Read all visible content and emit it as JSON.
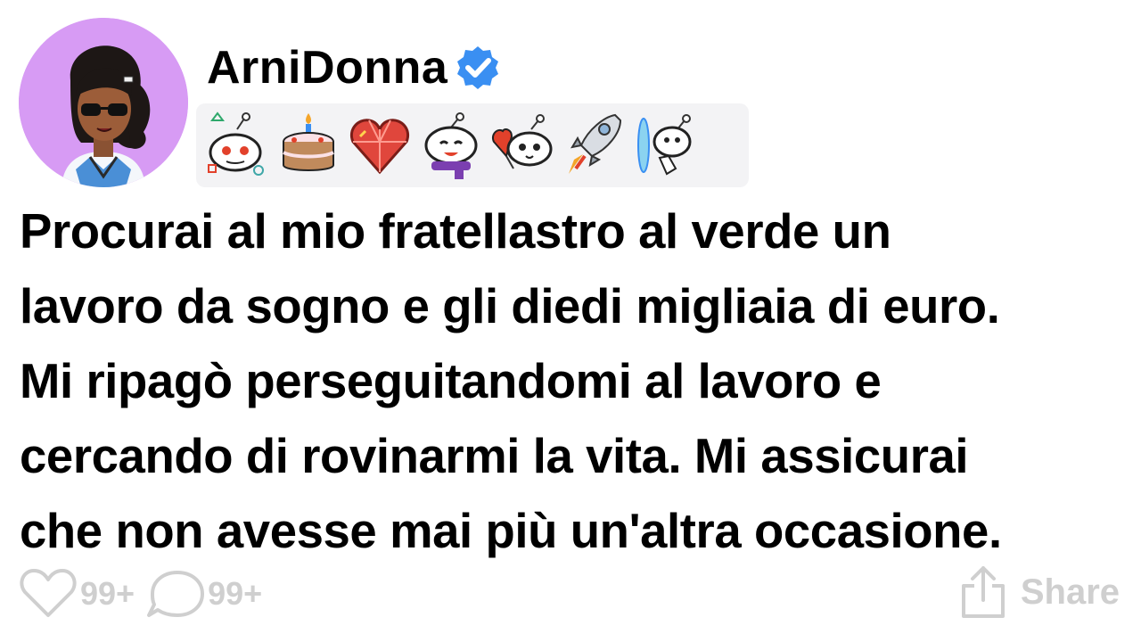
{
  "post": {
    "username": "ArniDonna",
    "verified": true,
    "avatar_bg": "#d79bf4",
    "trophies": [
      {
        "icon": "snoo-shapes-trophy-icon"
      },
      {
        "icon": "cake-day-trophy-icon"
      },
      {
        "icon": "gem-heart-trophy-icon"
      },
      {
        "icon": "snoo-scarf-trophy-icon"
      },
      {
        "icon": "snoo-heart-balloon-trophy-icon"
      },
      {
        "icon": "rocket-trophy-icon"
      },
      {
        "icon": "snoo-portal-trophy-icon"
      }
    ],
    "lines": [
      "Procurai al mio fratellastro al verde un",
      "lavoro da sogno e gli diedi migliaia di euro.",
      "Mi ripagò perseguitandomi al lavoro e",
      "cercando di rovinarmi la vita. Mi assicurai",
      "che non avesse mai più un'altra occasione."
    ]
  },
  "actions": {
    "likes": "99+",
    "comments": "99+",
    "share_label": "Share"
  },
  "colors": {
    "verified": "#3a8ff2",
    "muted": "#cfcfcf",
    "trophy_bg": "#f3f3f5"
  }
}
